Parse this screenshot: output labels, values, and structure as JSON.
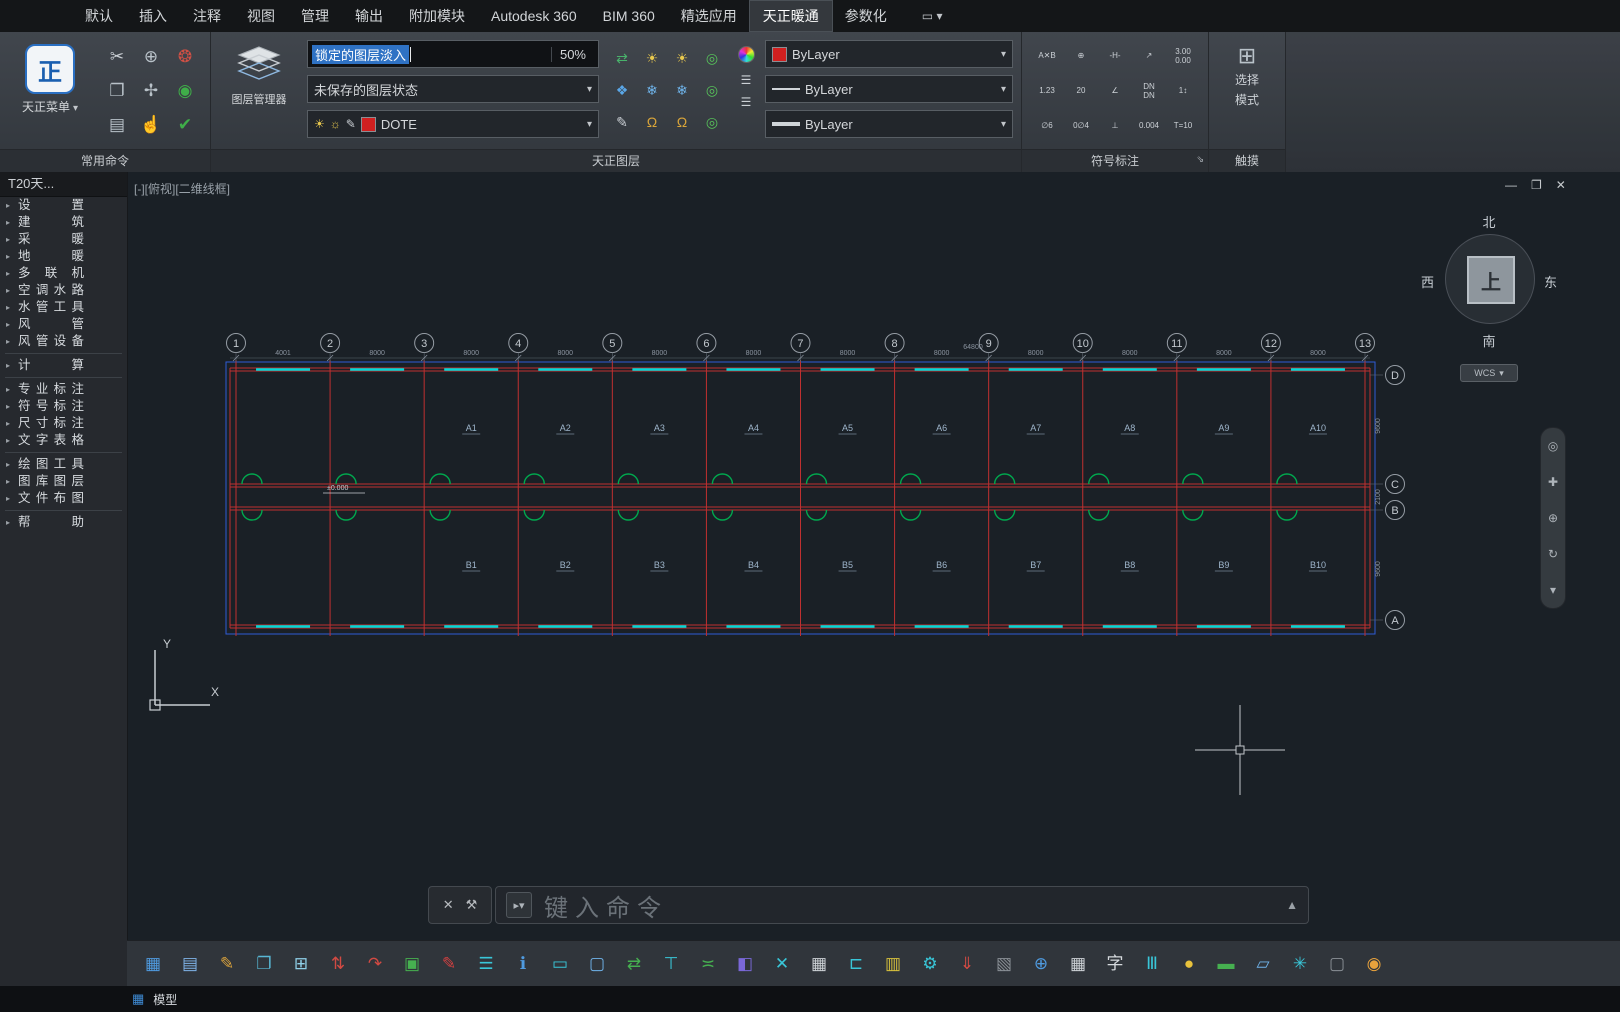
{
  "menu_bar": {
    "items": [
      "默认",
      "插入",
      "注释",
      "视图",
      "管理",
      "输出",
      "附加模块",
      "Autodesk 360",
      "BIM 360",
      "精选应用",
      "天正暖通",
      "参数化"
    ],
    "active": "天正暖通",
    "extra_icon_glyph": "▭ ▾"
  },
  "ribbon": {
    "tz_menu": {
      "label": "天正菜单",
      "logo_text": "正"
    },
    "common": {
      "label": "常用命令",
      "icons": [
        {
          "name": "cut-icon",
          "g": "✂",
          "c": "#c9ced3"
        },
        {
          "name": "zoom-icon",
          "g": "⊕",
          "c": "#b9c2c9"
        },
        {
          "name": "redraw-icon",
          "g": "❂",
          "c": "#d05045"
        },
        {
          "name": "copy-icon",
          "g": "❐",
          "c": "#b9c2c9"
        },
        {
          "name": "move-icon",
          "g": "✢",
          "c": "#b9c2c9"
        },
        {
          "name": "record-icon",
          "g": "◉",
          "c": "#3fae49"
        },
        {
          "name": "paste-icon",
          "g": "▤",
          "c": "#b9c2c9"
        },
        {
          "name": "pan-hand-icon",
          "g": "☝",
          "c": "#c9ced3"
        },
        {
          "name": "layer-check-icon",
          "g": "✔",
          "c": "#3fae49"
        }
      ]
    },
    "layer_manager": {
      "label": "图层管理器"
    },
    "tz_layer": {
      "label": "天正图层",
      "fade_label": "锁定的图层淡入",
      "fade_value": "50%",
      "state_dropdown": "未保存的图层状态",
      "layer_name": "DOTE",
      "bylayer_color": "ByLayer",
      "bylayer_linetype": "ByLayer",
      "bylayer_lineweight": "ByLayer",
      "grid_icons": [
        {
          "name": "layer-match-icon",
          "g": "⇄",
          "c": "#49b26b"
        },
        {
          "name": "layer-on-icon",
          "g": "☀",
          "c": "#e8c84e"
        },
        {
          "name": "layer-on-all-icon",
          "g": "☀",
          "c": "#e8c84e"
        },
        {
          "name": "layer-isolate-icon",
          "g": "◎",
          "c": "#57c25a"
        },
        {
          "name": "layer-walk-icon",
          "g": "❖",
          "c": "#5aa7e8"
        },
        {
          "name": "layer-freeze-icon",
          "g": "❄",
          "c": "#6fb3ea"
        },
        {
          "name": "layer-thaw-icon",
          "g": "❄",
          "c": "#6fb3ea"
        },
        {
          "name": "layer-restore-icon",
          "g": "◎",
          "c": "#57c25a"
        },
        {
          "name": "layer-edit-icon",
          "g": "✎",
          "c": "#c9ced3"
        },
        {
          "name": "layer-lock-icon",
          "g": "Ω",
          "c": "#d8a43a"
        },
        {
          "name": "layer-unlock-icon",
          "g": "Ω",
          "c": "#d8a43a"
        },
        {
          "name": "layer-current-icon",
          "g": "◎",
          "c": "#57c25a"
        }
      ]
    },
    "symbol": {
      "label": "符号标注",
      "cells": [
        "A✕B",
        "⊕",
        "-H-",
        "↗",
        "3.00\n0.00",
        "1.23",
        "20",
        "∠",
        "DN\nDN",
        "1↕",
        "∅6",
        "0∅4",
        "⊥",
        "0.004",
        "T=10"
      ]
    },
    "touch": {
      "label": "触摸",
      "line1": "选择",
      "line2": "模式"
    }
  },
  "sidebar": {
    "title": "T20天...",
    "items": [
      "设 置",
      "建 筑",
      "采 暖",
      "地 暖",
      "多 联 机",
      "空调水路",
      "水管工具",
      "风 管",
      "风管设备",
      "计 算",
      "专业标注",
      "符号标注",
      "尺寸标注",
      "文字表格",
      "绘图工具",
      "图库图层",
      "文件布图",
      "帮 助"
    ],
    "divider_after": [
      8,
      9,
      13,
      16
    ]
  },
  "canvas": {
    "view_label": "[-][俯视][二维线框]",
    "window_buttons": [
      "—",
      "❐",
      "✕"
    ],
    "viewcube": {
      "north": "北",
      "south": "南",
      "west": "西",
      "east": "东",
      "top": "上"
    },
    "wcs_label": "WCS",
    "command_line": {
      "placeholder": "键入命令"
    },
    "status_bar": {
      "model_tab": "模型"
    }
  },
  "drawing": {
    "grid_cols": [
      "1",
      "2",
      "3",
      "4",
      "5",
      "6",
      "7",
      "8",
      "9",
      "10",
      "11",
      "12",
      "13"
    ],
    "grid_rows": [
      "D",
      "C",
      "B",
      "A"
    ],
    "rooms_top": [
      "A1",
      "A2",
      "A3",
      "A4",
      "A5",
      "A6",
      "A7",
      "A8",
      "A9",
      "A10"
    ],
    "rooms_bottom": [
      "B1",
      "B2",
      "B3",
      "B4",
      "B5",
      "B6",
      "B7",
      "B8",
      "B9",
      "B10"
    ],
    "dims_top": [
      "4001",
      "8000",
      "8000",
      "8000",
      "8000",
      "8000",
      "8000",
      "8000",
      "8000",
      "8000",
      "8000",
      "8000"
    ],
    "dims_total": "64800",
    "dims_right": [
      "9600",
      "2100",
      "9600"
    ],
    "elevation": "±0.000",
    "colors": {
      "grid": "#c03030",
      "wall": "#00d8d8",
      "door": "#00a84e",
      "bubble": "#959ca4",
      "dim": "#8b94a0",
      "selection": "#2f5bd6",
      "room": "#9fb6cc"
    }
  },
  "bottom_toolbar": {
    "icons": [
      {
        "g": "▦",
        "c": "#4f9be0"
      },
      {
        "g": "▤",
        "c": "#7fb3e8"
      },
      {
        "g": "✎",
        "c": "#d9a23c"
      },
      {
        "g": "❐",
        "c": "#58b7d4"
      },
      {
        "g": "⊞",
        "c": "#8fd0e8"
      },
      {
        "g": "⇅",
        "c": "#d24a43"
      },
      {
        "g": "↷",
        "c": "#d24a43"
      },
      {
        "g": "▣",
        "c": "#46b050"
      },
      {
        "g": "✎",
        "c": "#d04040"
      },
      {
        "g": "☰",
        "c": "#39c6d8"
      },
      {
        "g": "ℹ",
        "c": "#4f9be0"
      },
      {
        "g": "▭",
        "c": "#39c6d8"
      },
      {
        "g": "▢",
        "c": "#6fb3ea"
      },
      {
        "g": "⇄",
        "c": "#46b050"
      },
      {
        "g": "⊤",
        "c": "#39c6d8"
      },
      {
        "g": "≍",
        "c": "#46b050"
      },
      {
        "g": "◧",
        "c": "#7a68d8"
      },
      {
        "g": "✕",
        "c": "#39c6d8"
      },
      {
        "g": "▦",
        "c": "#cdd2d6"
      },
      {
        "g": "⊏",
        "c": "#39c6d8"
      },
      {
        "g": "▥",
        "c": "#d8c23c"
      },
      {
        "g": "⚙",
        "c": "#39c6d8"
      },
      {
        "g": "⇓",
        "c": "#d24a43"
      },
      {
        "g": "▧",
        "c": "#8a9096"
      },
      {
        "g": "⊕",
        "c": "#4f9be0"
      },
      {
        "g": "▦",
        "c": "#cdd2d6"
      },
      {
        "g": "字",
        "c": "#d6dade"
      },
      {
        "g": "Ⅲ",
        "c": "#39c6d8"
      },
      {
        "g": "●",
        "c": "#e8c23c"
      },
      {
        "g": "▬",
        "c": "#46b050"
      },
      {
        "g": "▱",
        "c": "#6fb3ea"
      },
      {
        "g": "✳",
        "c": "#39c6d8"
      },
      {
        "g": "▢",
        "c": "#8a9096"
      },
      {
        "g": "◉",
        "c": "#e8a23c"
      }
    ]
  }
}
